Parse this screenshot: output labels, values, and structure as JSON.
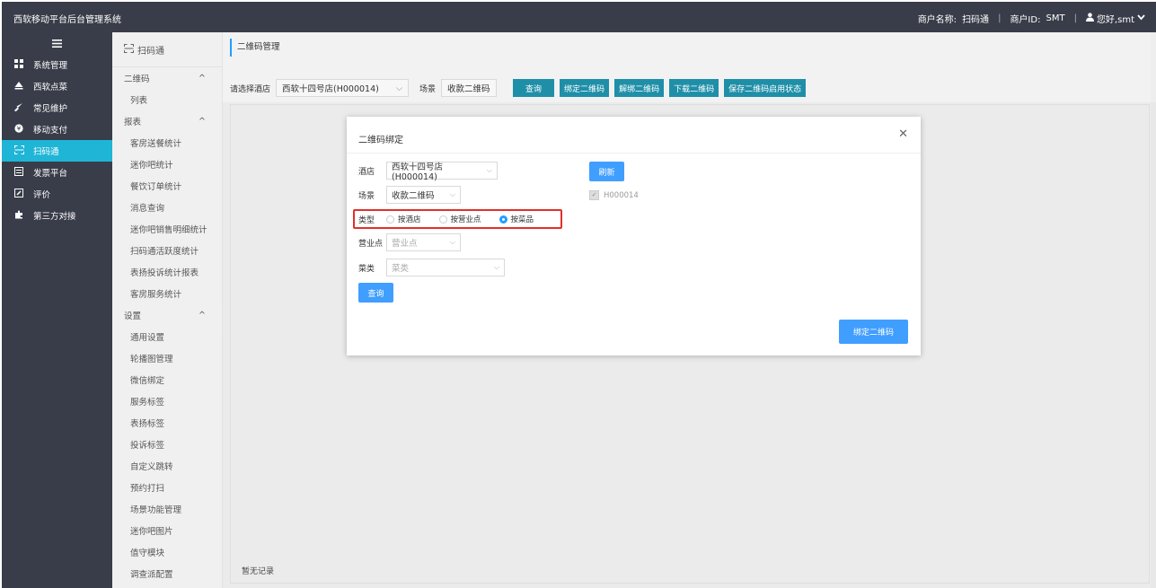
{
  "header": {
    "title": "西软移动平台后台管理系统",
    "merchant_name_label": "商户名称:",
    "merchant_name": "扫码通",
    "merchant_id_label": "商户ID:",
    "merchant_id": "SMT",
    "greeting": "您好,smt"
  },
  "sidebar": {
    "items": [
      {
        "label": "系统管理",
        "icon": "grid-icon"
      },
      {
        "label": "西软点菜",
        "icon": "eject-icon"
      },
      {
        "label": "常见维护",
        "icon": "wrench-icon"
      },
      {
        "label": "移动支付",
        "icon": "coin-icon"
      },
      {
        "label": "扫码通",
        "icon": "scan-icon"
      },
      {
        "label": "发票平台",
        "icon": "list-icon"
      },
      {
        "label": "评价",
        "icon": "edit-icon"
      },
      {
        "label": "第三方对接",
        "icon": "puzzle-icon"
      }
    ],
    "active_index": 4
  },
  "subnav": {
    "title": "扫码通",
    "groups": [
      {
        "label": "二维码",
        "items": [
          "列表"
        ]
      },
      {
        "label": "报表",
        "items": [
          "客房送餐统计",
          "迷你吧统计",
          "餐饮订单统计",
          "消息查询",
          "迷你吧销售明细统计",
          "扫码通活跃度统计",
          "表扬投诉统计报表",
          "客房服务统计"
        ]
      },
      {
        "label": "设置",
        "items": [
          "通用设置",
          "轮播图管理",
          "微信绑定",
          "服务标签",
          "表扬标签",
          "投诉标签",
          "自定义跳转",
          "预约打扫",
          "场景功能管理",
          "迷你吧图片",
          "值守模块",
          "调查派配置"
        ]
      }
    ]
  },
  "main": {
    "breadcrumb": "二维码管理",
    "filter": {
      "hotel_label": "请选择酒店",
      "hotel_value": "西软十四号店(H000014)",
      "scene_label": "场景",
      "scene_value": "收款二维码"
    },
    "buttons": [
      "查询",
      "绑定二维码",
      "解绑二维码",
      "下载二维码",
      "保存二维码启用状态"
    ],
    "empty_text": "暂无记录"
  },
  "modal": {
    "title": "二维码绑定",
    "hotel_label": "酒店",
    "hotel_value": "西软十四号店(H000014)",
    "scene_label": "场景",
    "scene_value": "收款二维码",
    "type_label": "类型",
    "type_options": [
      "按酒店",
      "按营业点",
      "按菜品"
    ],
    "type_selected": 2,
    "outlet_label": "营业点",
    "outlet_placeholder": "营业点",
    "category_label": "菜类",
    "category_placeholder": "菜类",
    "query_button": "查询",
    "refresh_button": "刷新",
    "checked_item": "H000014",
    "bind_button": "绑定二维码"
  },
  "colors": {
    "topbar": "#393d49",
    "active": "#1fb5d6",
    "teal_button": "#1f8fa8",
    "blue_button": "#409eff",
    "highlight": "#e0302c"
  }
}
